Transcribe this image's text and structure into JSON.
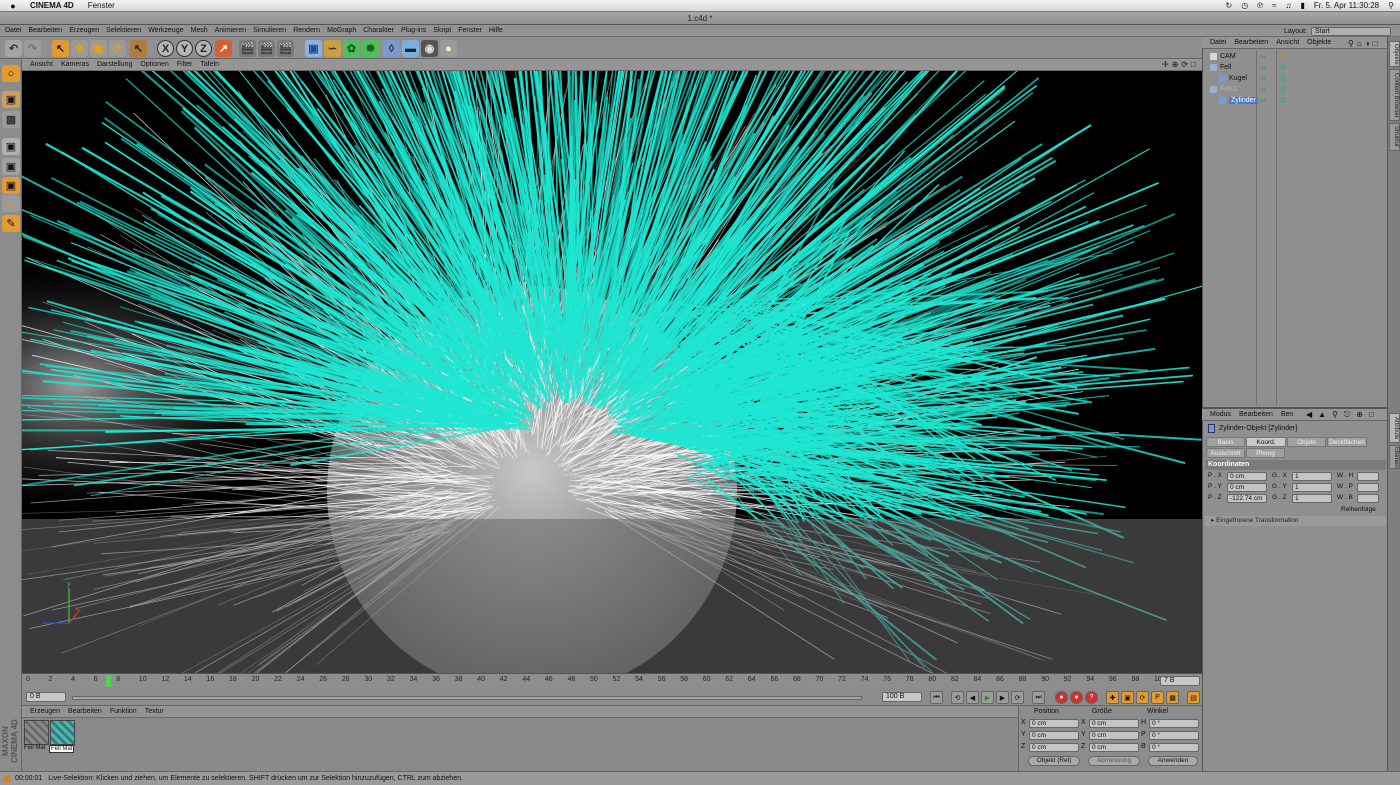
{
  "macbar": {
    "apple": "",
    "app_name": "CINEMA 4D",
    "menu": "Fenster",
    "datetime": "Fr. 5. Apr  11:30:28"
  },
  "window": {
    "title": "1.c4d *"
  },
  "appmenu": {
    "items": [
      "Datei",
      "Bearbeiten",
      "Erzeugen",
      "Selektieren",
      "Werkzeuge",
      "Mesh",
      "Animieren",
      "Simulieren",
      "Rendern",
      "MoGraph",
      "Charakter",
      "Plug-ins",
      "Skript",
      "Fenster",
      "Hilfe"
    ],
    "layout_label": "Layout:",
    "layout_value": "Start"
  },
  "toolbar": {
    "axis_x": "X",
    "axis_y": "Y",
    "axis_z": "Z"
  },
  "viewport": {
    "menu": [
      "Ansicht",
      "Kameras",
      "Darstellung",
      "Optionen",
      "Filter",
      "Tafeln"
    ],
    "axis_x": "x",
    "axis_y": "y",
    "hair_color": "#1ee6d2",
    "hair_white": "#ffffff",
    "background": "#000000"
  },
  "timeline": {
    "ticks": [
      "0",
      "2",
      "4",
      "6",
      "8",
      "10",
      "12",
      "14",
      "16",
      "18",
      "20",
      "22",
      "24",
      "26",
      "28",
      "30",
      "32",
      "34",
      "36",
      "38",
      "40",
      "42",
      "44",
      "46",
      "48",
      "50",
      "52",
      "54",
      "56",
      "58",
      "60",
      "62",
      "64",
      "66",
      "68",
      "70",
      "72",
      "74",
      "76",
      "78",
      "80",
      "82",
      "84",
      "86",
      "88",
      "90",
      "92",
      "94",
      "96",
      "98",
      "100"
    ],
    "current_frame_marker": "7",
    "current_frame_field": "7 B",
    "start_field": "0 B",
    "end_field": "100 B",
    "range_label": "100 B"
  },
  "material_manager": {
    "menu": [
      "Erzeugen",
      "Bearbeiten",
      "Funktion",
      "Textur"
    ],
    "materials": [
      {
        "label": "Fell Mat",
        "selected": false
      },
      {
        "label": "Fell Mat",
        "selected": true
      }
    ],
    "logo_line1": "MAXON",
    "logo_line2": "CINEMA 4D"
  },
  "coordinates": {
    "headers": [
      "Position",
      "Größe",
      "Winkel"
    ],
    "rows": [
      {
        "pos_axis": "X",
        "pos": "0 cm",
        "size_axis": "X",
        "size": "0 cm",
        "rot_axis": "H",
        "rot": "0 °"
      },
      {
        "pos_axis": "Y",
        "pos": "0 cm",
        "size_axis": "Y",
        "size": "0 cm",
        "rot_axis": "P",
        "rot": "0 °"
      },
      {
        "pos_axis": "Z",
        "pos": "0 cm",
        "size_axis": "Z",
        "size": "0 cm",
        "rot_axis": "B",
        "rot": "0 °"
      }
    ],
    "mode_select": "Objekt (Rel)",
    "size_select": "Abmessung",
    "apply_button": "Anwenden"
  },
  "status": {
    "time": "00:00:01",
    "message": "Live-Selektion: Klicken und ziehen, um Elemente zu selektieren. SHIFT drücken um zur Selektion hinzuzufügen, CTRL zum abziehen."
  },
  "object_manager": {
    "menu": [
      "Datei",
      "Bearbeiten",
      "Ansicht",
      "Objekte"
    ],
    "objects": [
      {
        "name": "CAM",
        "indent": 0,
        "state": "normal"
      },
      {
        "name": "Fell",
        "indent": 0,
        "state": "normal"
      },
      {
        "name": "Kugel",
        "indent": 1,
        "state": "normal"
      },
      {
        "name": "Fell.1",
        "indent": 0,
        "state": "dimmed"
      },
      {
        "name": "Zylinder",
        "indent": 1,
        "state": "selected"
      }
    ]
  },
  "side_tabs": [
    "Objekte",
    "Content Browser",
    "Struktur",
    "Attribute",
    "Ebenen"
  ],
  "attribute_manager": {
    "menu": [
      "Modus",
      "Bearbeiten",
      "Ben"
    ],
    "object_title": "Zylinder-Objekt [Zylinder]",
    "tabs_row1": [
      {
        "label": "Basis",
        "active": false
      },
      {
        "label": "Koord.",
        "active": true
      },
      {
        "label": "Objekt",
        "active": false
      },
      {
        "label": "Deckflächen",
        "active": false
      }
    ],
    "tabs_row2": [
      {
        "label": "Ausschnitt",
        "active": false
      },
      {
        "label": "Phong",
        "active": false
      }
    ],
    "section": "Koordinaten",
    "rows": [
      {
        "p_label": "P . X",
        "p_val": "0 cm",
        "g_label": "G . X",
        "g_val": "1",
        "w_label": "W . H"
      },
      {
        "p_label": "P . Y",
        "p_val": "0 cm",
        "g_label": "G . Y",
        "g_val": "1",
        "w_label": "W . P"
      },
      {
        "p_label": "P . Z",
        "p_val": "-122.74 cm",
        "g_label": "G . Z",
        "g_val": "1",
        "w_label": "W . B"
      }
    ],
    "order_label": "Reihenfolge",
    "frozen": "Eingefrorene Transformation"
  }
}
